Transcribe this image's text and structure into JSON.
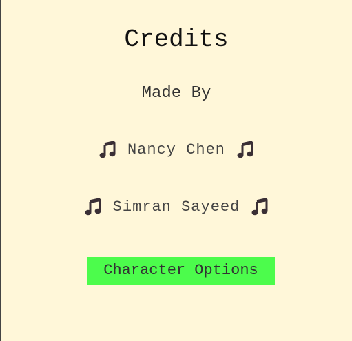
{
  "credits": {
    "title": "Credits",
    "subtitle": "Made By",
    "people": [
      {
        "name": "Nancy Chen",
        "icon": "music-note-icon"
      },
      {
        "name": "Simran Sayeed",
        "icon": "music-note-icon"
      }
    ]
  },
  "actions": {
    "character_options_label": "Character Options"
  },
  "colors": {
    "background": "#fff7d9",
    "button": "#4cfc4c",
    "icon": "#3a2f35"
  }
}
